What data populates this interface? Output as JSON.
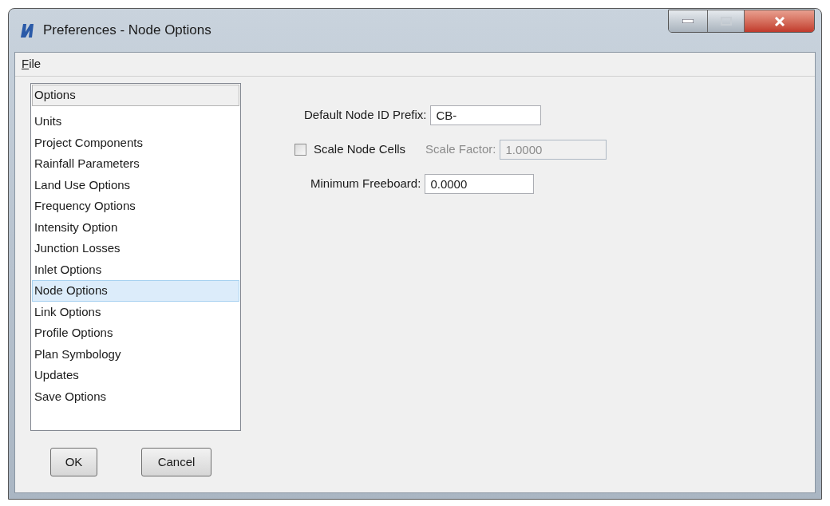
{
  "window": {
    "title": "Preferences - Node Options"
  },
  "menu": [
    "File"
  ],
  "list": {
    "header": "Options",
    "items": [
      {
        "label": "Units",
        "selected": false
      },
      {
        "label": "Project Components",
        "selected": false
      },
      {
        "label": "Rainfall Parameters",
        "selected": false
      },
      {
        "label": "Land Use Options",
        "selected": false
      },
      {
        "label": "Frequency Options",
        "selected": false
      },
      {
        "label": "Intensity Option",
        "selected": false
      },
      {
        "label": "Junction Losses",
        "selected": false
      },
      {
        "label": "Inlet Options",
        "selected": false
      },
      {
        "label": "Node Options",
        "selected": true
      },
      {
        "label": "Link Options",
        "selected": false
      },
      {
        "label": "Profile Options",
        "selected": false
      },
      {
        "label": "Plan Symbology",
        "selected": false
      },
      {
        "label": "Updates",
        "selected": false
      },
      {
        "label": "Save Options",
        "selected": false
      }
    ]
  },
  "fields": {
    "prefix": {
      "label": "Default Node ID Prefix:",
      "value": "CB-"
    },
    "scale_cells": {
      "label": "Scale Node Cells",
      "checked": false
    },
    "scale_factor": {
      "label": "Scale Factor:",
      "value": "1.0000",
      "disabled": true
    },
    "freeboard": {
      "label": "Minimum Freeboard:",
      "value": "0.0000"
    }
  },
  "buttons": [
    "OK",
    "Cancel"
  ]
}
